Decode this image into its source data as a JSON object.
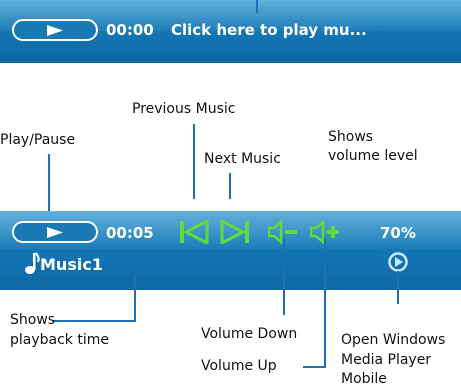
{
  "top_bar": {
    "time": "00:00",
    "status_text": "Click here to play mu..."
  },
  "player_bar": {
    "time": "00:05",
    "volume": "70%",
    "track": "Music1"
  },
  "callouts": {
    "previous": "Previous Music",
    "play_pause": "Play/Pause",
    "next": "Next Music",
    "shows_volume_1": "Shows",
    "shows_volume_2": "volume level",
    "shows_time_1": "Shows",
    "shows_time_2": "playback time",
    "volume_down": "Volume Down",
    "volume_up": "Volume Up",
    "open_wmp_1": "Open Windows",
    "open_wmp_2": "Media Player",
    "open_wmp_3": "Mobile"
  },
  "colors": {
    "bar_blue": "#1478b5",
    "control_green": "#5ddc3a",
    "callout_line": "#1f6fb5"
  },
  "icons": {
    "play": "play-icon",
    "previous": "skip-previous-icon",
    "next": "skip-next-icon",
    "volume_down": "volume-down-icon",
    "volume_up": "volume-up-icon",
    "music_note": "music-note-icon",
    "open_player": "open-player-icon"
  }
}
